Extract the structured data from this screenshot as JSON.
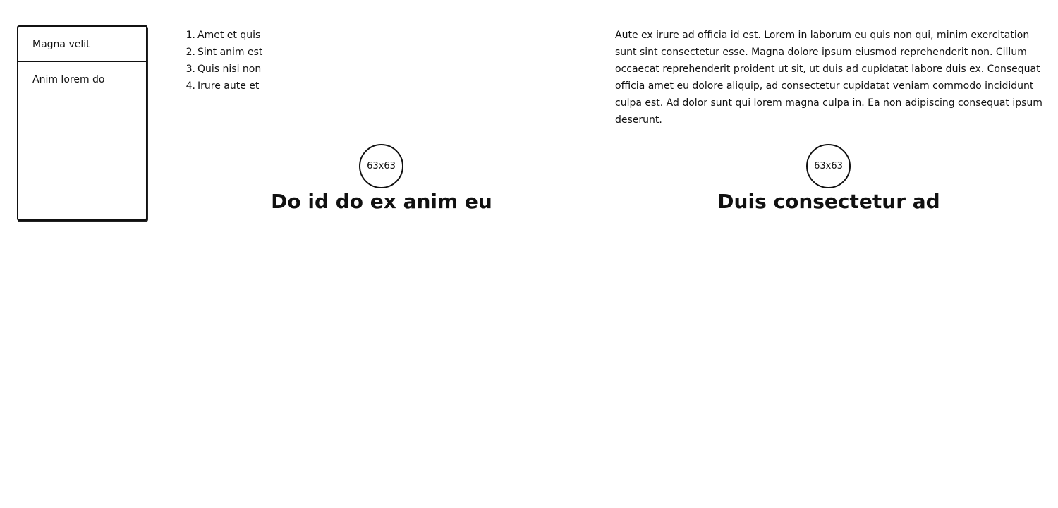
{
  "sidebar": {
    "items": [
      {
        "label": "Magna velit"
      },
      {
        "label": "Anim lorem do"
      }
    ]
  },
  "list": {
    "items": [
      {
        "number": "1.",
        "text": "Amet et quis"
      },
      {
        "number": "2.",
        "text": "Sint anim est"
      },
      {
        "number": "3.",
        "text": "Quis nisi non"
      },
      {
        "number": "4.",
        "text": "Irure aute et"
      }
    ]
  },
  "paragraph": {
    "text": "Aute ex irure ad officia id est. Lorem in laborum eu quis non qui, minim exercitation sunt sint consectetur esse. Magna dolore ipsum eiusmod reprehenderit non. Cillum occaecat reprehenderit proident ut sit, ut duis ad cupidatat labore duis ex. Consequat officia amet eu dolore aliquip, ad consectetur cupidatat veniam commodo incididunt culpa est. Ad dolor sunt qui lorem magna culpa in. Ea non adipiscing consequat ipsum deserunt."
  },
  "cards": [
    {
      "avatar_label": "63x63",
      "title": "Do id do ex anim eu"
    },
    {
      "avatar_label": "63x63",
      "title": "Duis consectetur ad"
    }
  ]
}
